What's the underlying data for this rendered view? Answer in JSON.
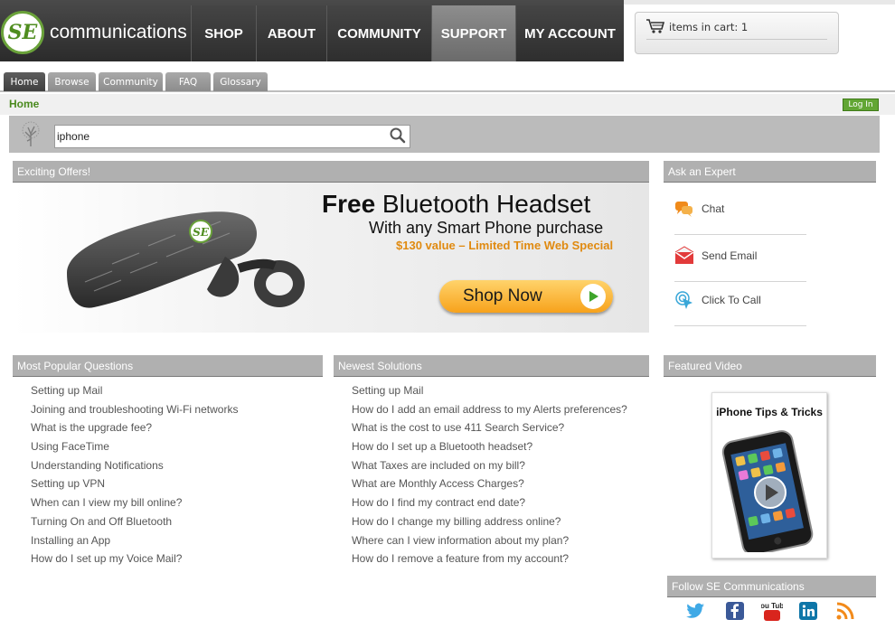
{
  "header": {
    "logo_mark": "SE",
    "logo_text": "communications",
    "nav": [
      "SHOP",
      "ABOUT",
      "COMMUNITY",
      "SUPPORT",
      "MY ACCOUNT"
    ],
    "active_nav": "SUPPORT",
    "cart_text": "items in cart: 1"
  },
  "subtabs": [
    "Home",
    "Browse",
    "Community",
    "FAQ",
    "Glossary"
  ],
  "breadcrumb": "Home",
  "login_label": "Log In",
  "search": {
    "value": "iphone"
  },
  "offers": {
    "heading": "Exciting Offers!",
    "title_bold": "Free",
    "title_rest": " Bluetooth Headset",
    "subtitle": "With any Smart Phone purchase",
    "note": "$130 value – Limited Time Web Special",
    "button": "Shop Now",
    "product_logo": "SE"
  },
  "expert": {
    "heading": "Ask an Expert",
    "items": [
      "Chat",
      "Send Email",
      "Click To Call"
    ]
  },
  "popular": {
    "heading": "Most Popular Questions",
    "items": [
      "Setting up Mail",
      "Joining and troubleshooting Wi-Fi networks",
      "What is the upgrade fee?",
      "Using FaceTime",
      "Understanding Notifications",
      "Setting up VPN",
      "When can I view my bill online?",
      "Turning On and Off Bluetooth",
      "Installing an App",
      "How do I set up my Voice Mail?"
    ]
  },
  "newest": {
    "heading": "Newest Solutions",
    "items": [
      "Setting up Mail",
      "How do I add an email address to my Alerts preferences?",
      "What is the cost to use 411 Search Service?",
      "How do I set up a Bluetooth headset?",
      "What Taxes are included on my bill?",
      "What are Monthly Access Charges?",
      "How do I find my contract end date?",
      "How do I change my billing address online?",
      "Where can I view information about my plan?",
      "How do I remove a feature from my account?"
    ]
  },
  "video": {
    "heading": "Featured Video",
    "title": "iPhone Tips & Tricks"
  },
  "follow": {
    "heading": "Follow SE Communications",
    "icons": [
      "twitter-icon",
      "facebook-icon",
      "youtube-icon",
      "linkedin-icon",
      "rss-icon"
    ],
    "youtube_label": "You Tube"
  },
  "colors": {
    "brand_green": "#4a8a1e",
    "header_dark": "#2b2b2b",
    "panel_gray": "#b0b0b0",
    "cta_orange": "#f7a21b"
  }
}
